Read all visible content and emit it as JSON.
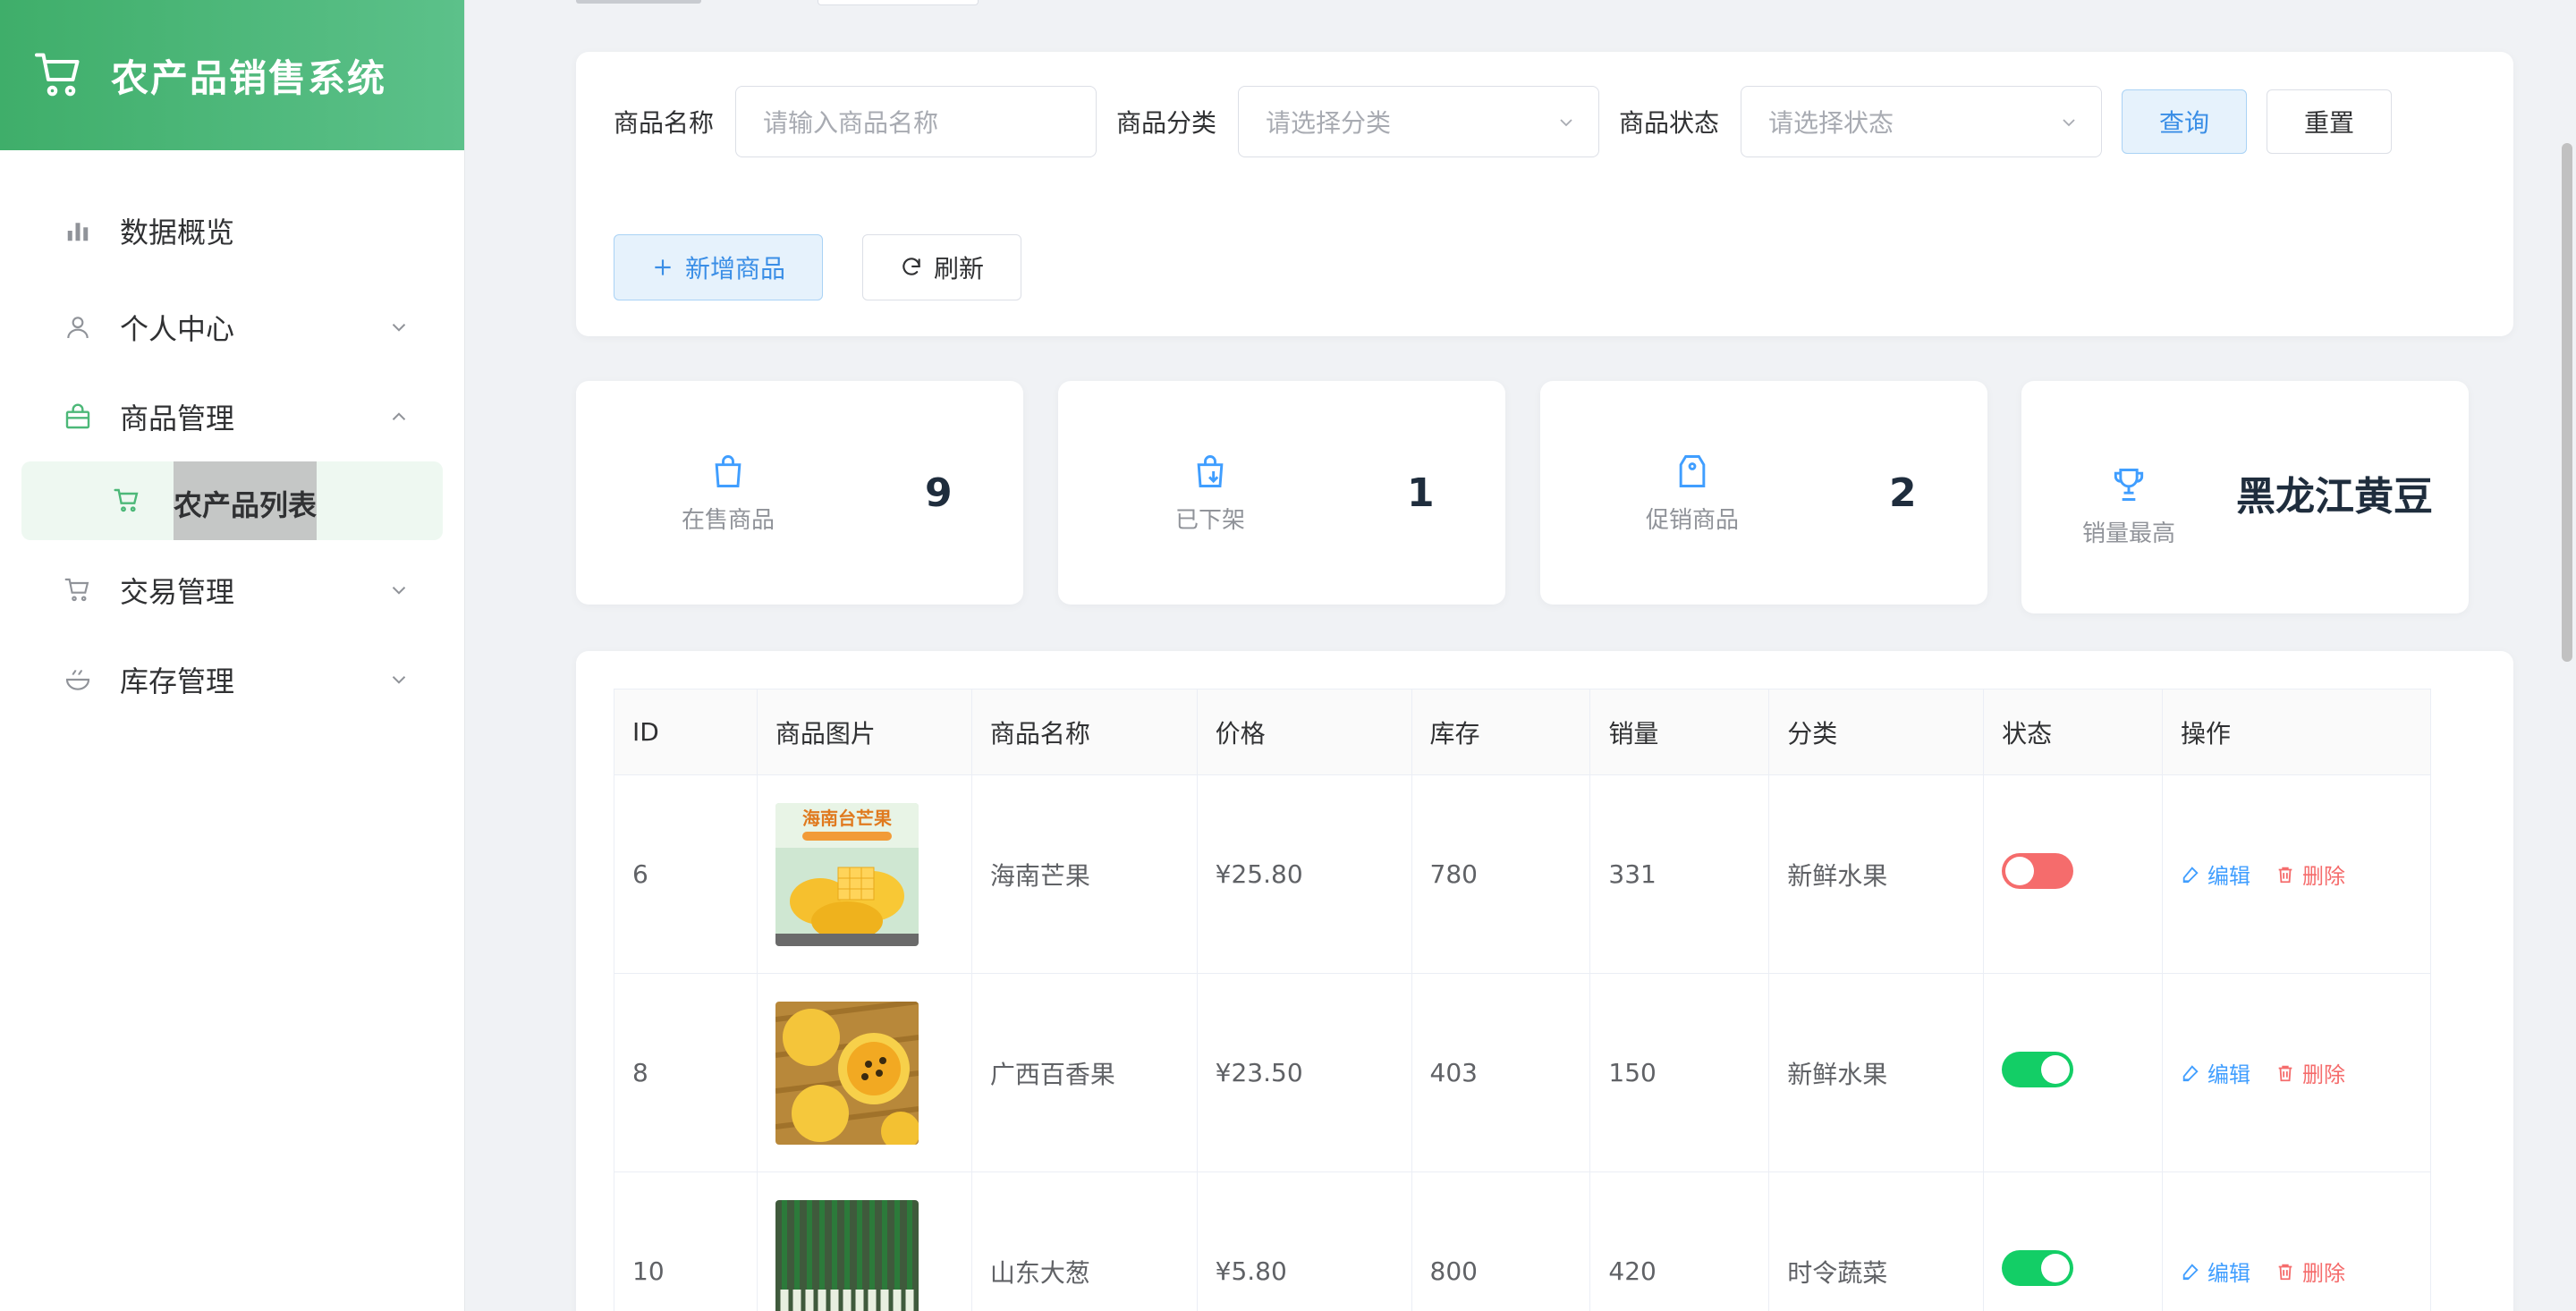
{
  "app": {
    "title": "农产品销售系统"
  },
  "sidebar": {
    "items": [
      {
        "label": "数据概览",
        "icon": "bar-chart-icon"
      },
      {
        "label": "个人中心",
        "icon": "user-icon",
        "arrow": "chevron-down-icon"
      },
      {
        "label": "商品管理",
        "icon": "shopping-bag-icon",
        "arrow": "chevron-up-icon"
      },
      {
        "label": "交易管理",
        "icon": "cart-icon",
        "arrow": "chevron-down-icon"
      },
      {
        "label": "库存管理",
        "icon": "bowl-icon",
        "arrow": "chevron-down-icon"
      }
    ],
    "submenu": {
      "label": "农产品列表",
      "icon": "cart-icon"
    }
  },
  "filters": {
    "name_label": "商品名称",
    "name_placeholder": "请输入商品名称",
    "category_label": "商品分类",
    "category_placeholder": "请选择分类",
    "status_label": "商品状态",
    "status_placeholder": "请选择状态",
    "query_label": "查询",
    "reset_label": "重置"
  },
  "actions": {
    "add_label": "新增商品",
    "refresh_label": "刷新"
  },
  "stats": [
    {
      "label": "在售商品",
      "value": "9",
      "icon": "bag-icon"
    },
    {
      "label": "已下架",
      "value": "1",
      "icon": "bag-down-icon"
    },
    {
      "label": "促销商品",
      "value": "2",
      "icon": "tag-icon"
    },
    {
      "label": "销量最高",
      "value": "黑龙江黄豆",
      "icon": "trophy-icon"
    }
  ],
  "table": {
    "columns": [
      "ID",
      "商品图片",
      "商品名称",
      "价格",
      "库存",
      "销量",
      "分类",
      "状态",
      "操作"
    ],
    "rows": [
      {
        "id": "6",
        "image_text": "海南台芒果",
        "name": "海南芒果",
        "price": "¥25.80",
        "stock": "780",
        "sales": "331",
        "category": "新鲜水果",
        "status": "off"
      },
      {
        "id": "8",
        "name": "广西百香果",
        "price": "¥23.50",
        "stock": "403",
        "sales": "150",
        "category": "新鲜水果",
        "status": "on"
      },
      {
        "id": "10",
        "name": "山东大葱",
        "price": "¥5.80",
        "stock": "800",
        "sales": "420",
        "category": "时令蔬菜",
        "status": "on"
      }
    ],
    "edit_label": "编辑",
    "delete_label": "删除"
  },
  "colors": {
    "brand": "#4cb878",
    "primary": "#409eff",
    "danger": "#f56c6c",
    "success": "#13ce66"
  }
}
